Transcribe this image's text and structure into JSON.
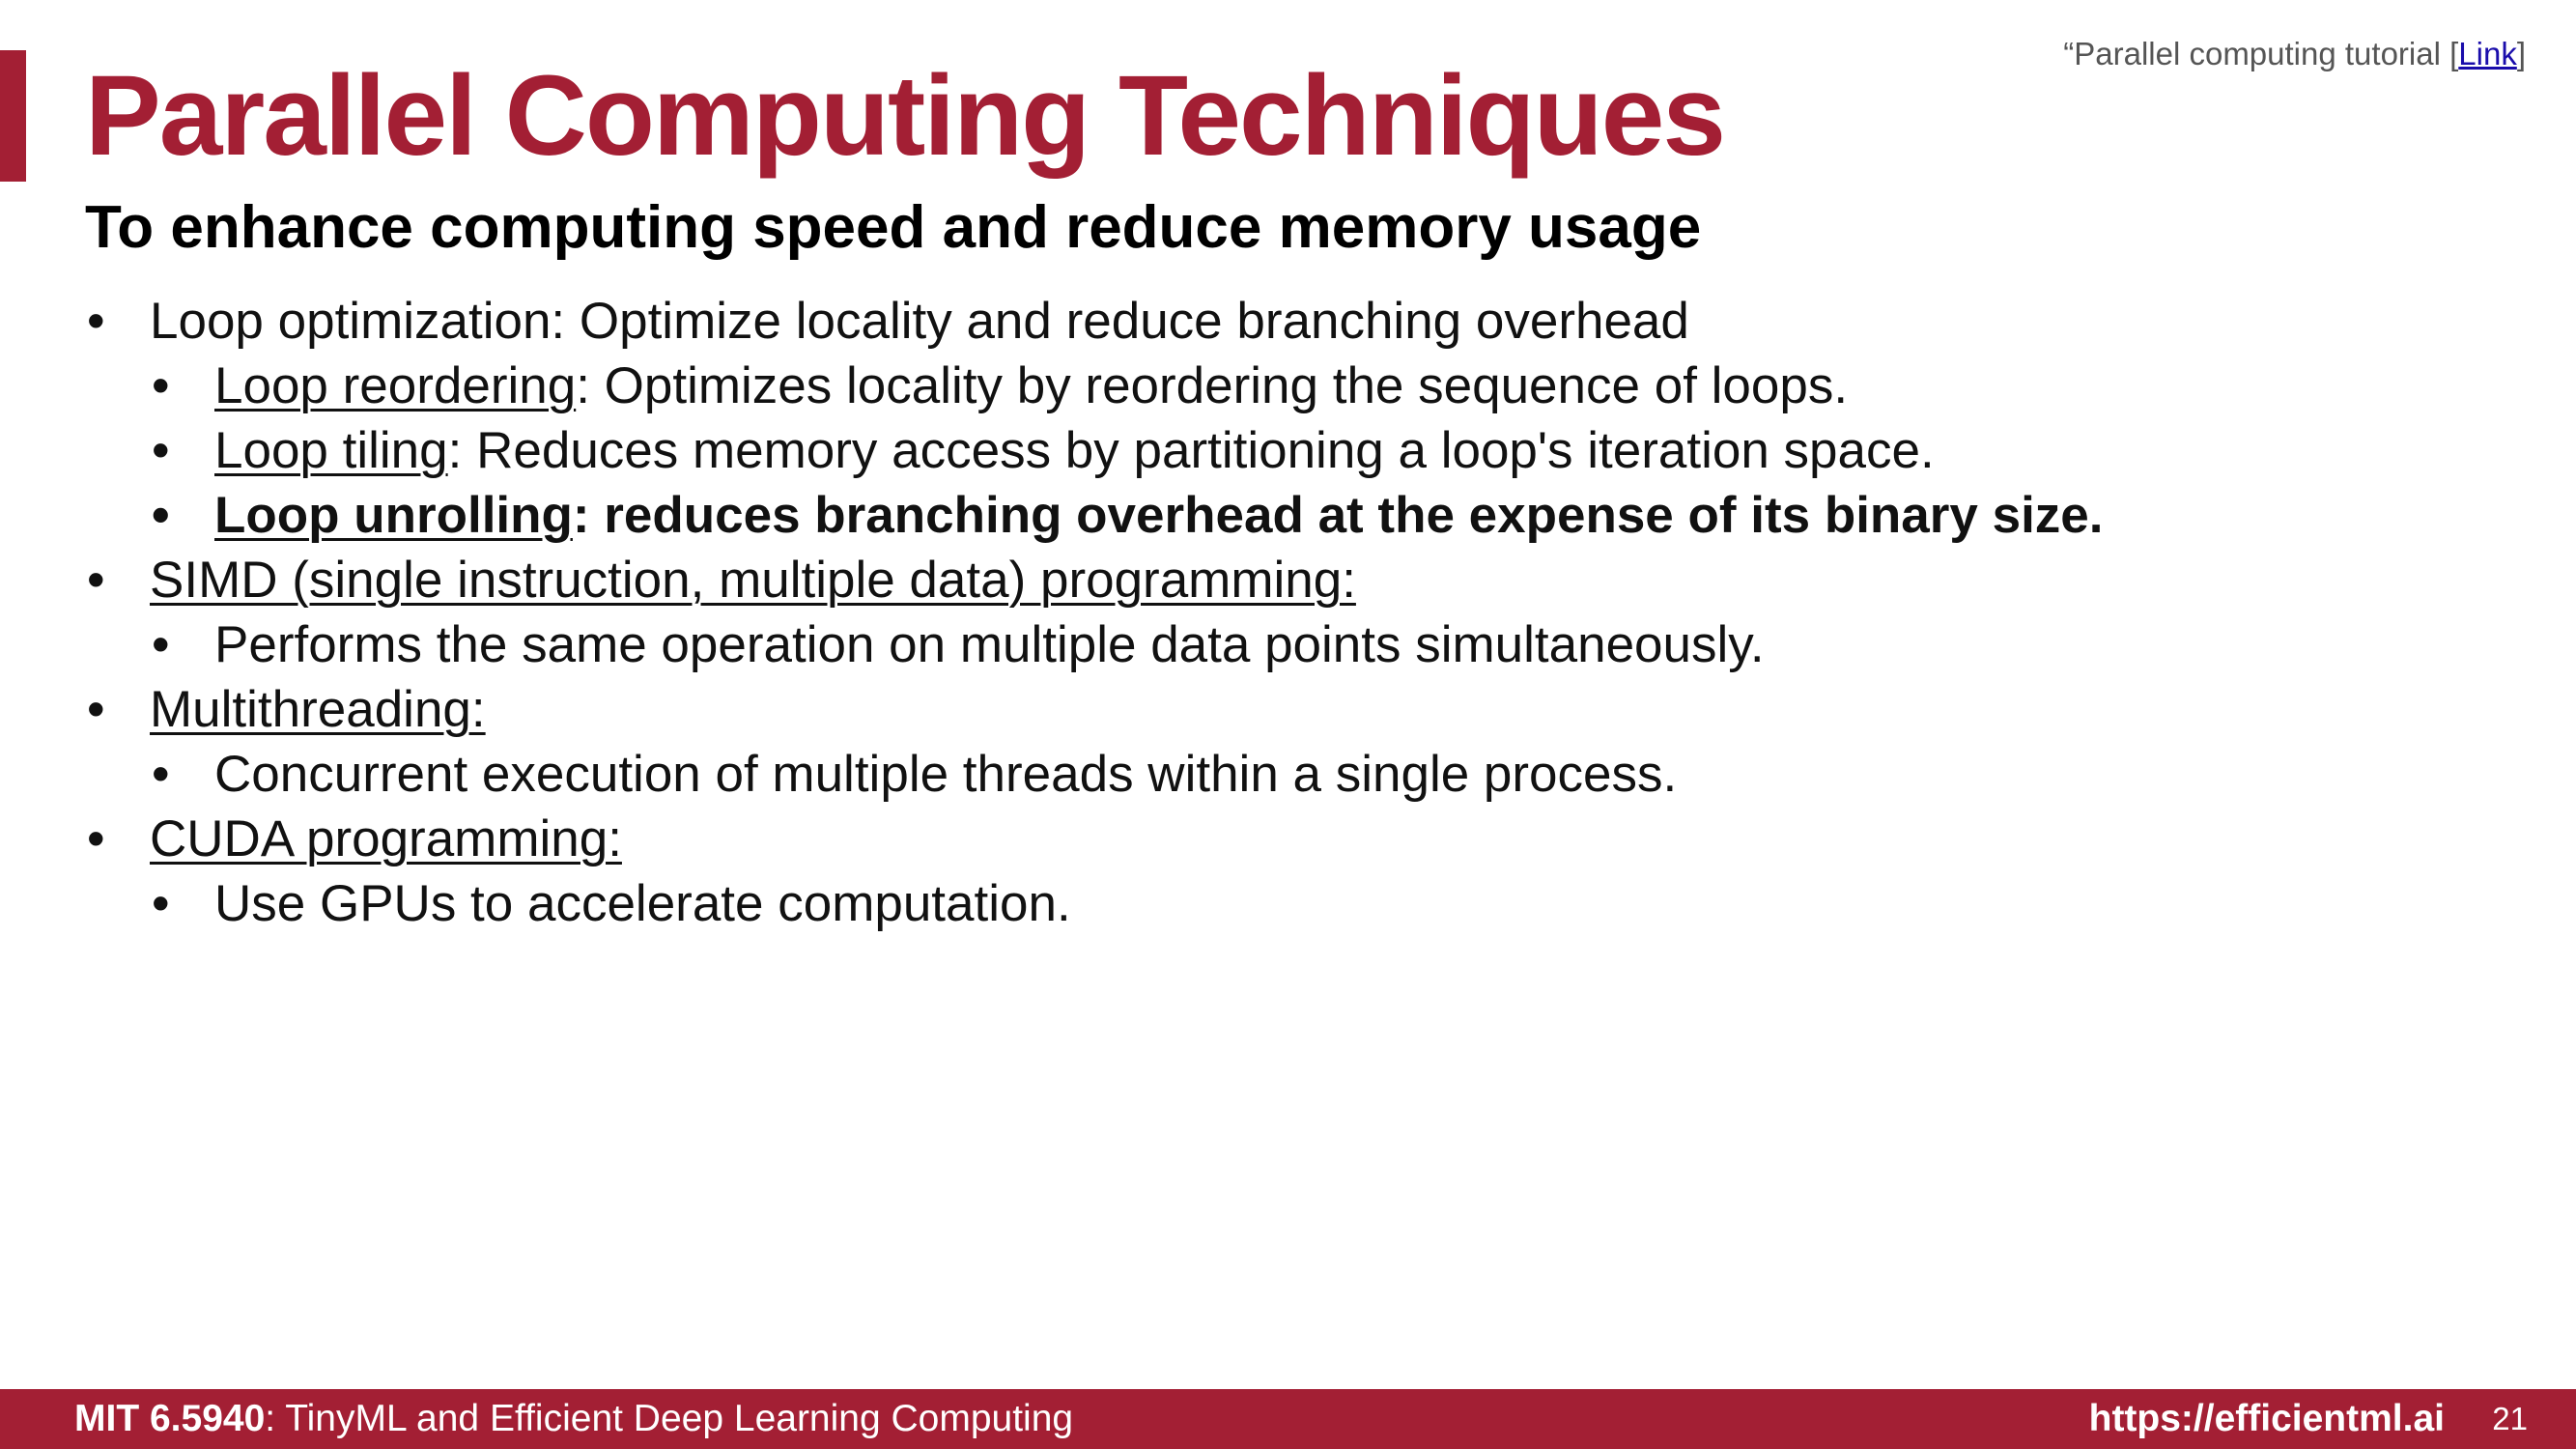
{
  "slide": {
    "title": "Parallel Computing Techniques",
    "subtitle": "To enhance computing speed and reduce memory usage",
    "reference": {
      "prefix": "“Parallel computing tutorial [",
      "link_text": "Link",
      "suffix": "]"
    },
    "bullet_glyph": "•",
    "bullets": [
      {
        "level": 1,
        "lead": "",
        "text": "Loop optimization: Optimize locality and reduce branching overhead"
      },
      {
        "level": 2,
        "lead": "Loop reordering",
        "text": ": Optimizes locality by reordering the sequence of loops."
      },
      {
        "level": 2,
        "lead": "Loop tiling",
        "text": ": Reduces memory access by partitioning a loop's iteration space."
      },
      {
        "level": 2,
        "lead": "Loop unrolling",
        "text": ": reduces branching overhead at the expense of its binary size.",
        "bold": true
      },
      {
        "level": 1,
        "lead": "SIMD (single instruction, multiple data) programming:",
        "text": ""
      },
      {
        "level": 2,
        "lead": "",
        "text": "Performs the same operation on multiple data points simultaneously."
      },
      {
        "level": 1,
        "lead": "Multithreading:",
        "text": ""
      },
      {
        "level": 2,
        "lead": "",
        "text": "Concurrent execution of multiple threads within a single process."
      },
      {
        "level": 1,
        "lead": "CUDA programming:",
        "text": ""
      },
      {
        "level": 2,
        "lead": "",
        "text": "Use GPUs to accelerate computation."
      }
    ]
  },
  "footer": {
    "course_code": "MIT 6.5940",
    "course_name": ": TinyML and Efficient Deep Learning Computing",
    "url": "https://efficientml.ai",
    "page_number": "21"
  },
  "colors": {
    "accent": "#A31F34",
    "text": "#111111",
    "link": "#1a0dab"
  }
}
